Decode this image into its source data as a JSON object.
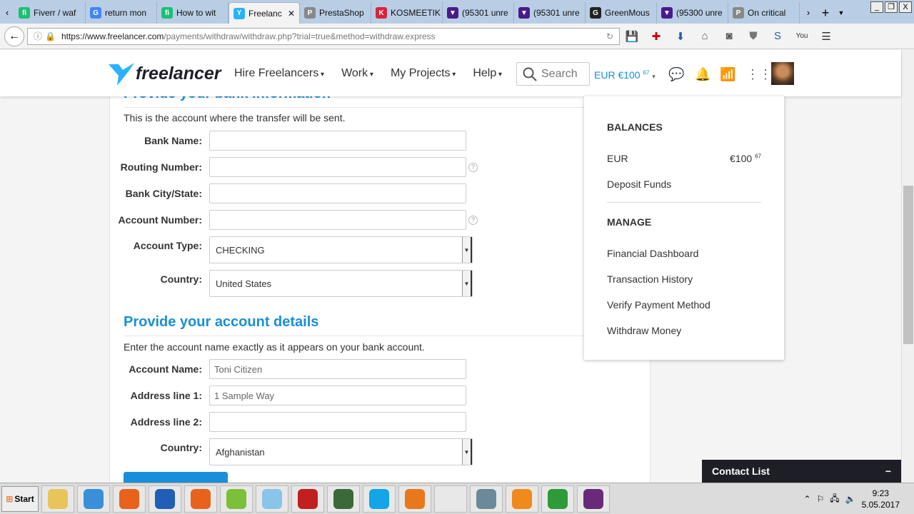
{
  "browser": {
    "tabs": [
      {
        "label": "Fiverr / waf",
        "color": "#1dbf73",
        "glyph": "fi"
      },
      {
        "label": "return mon",
        "color": "#4285f4",
        "glyph": "G"
      },
      {
        "label": "How to wit",
        "color": "#1dbf73",
        "glyph": "fi"
      },
      {
        "label": "Freelanc",
        "color": "#29b2fe",
        "glyph": "Y",
        "active": true
      },
      {
        "label": "PrestaShop",
        "color": "#888888",
        "glyph": "P"
      },
      {
        "label": "KOSMEETIK",
        "color": "#d9233d",
        "glyph": "K"
      },
      {
        "label": "(95301 unre",
        "color": "#4b1a8a",
        "glyph": "▼"
      },
      {
        "label": "(95301 unre",
        "color": "#4b1a8a",
        "glyph": "▼"
      },
      {
        "label": "GreenMous",
        "color": "#222222",
        "glyph": "G"
      },
      {
        "label": "(95300 unre",
        "color": "#4b1a8a",
        "glyph": "▼"
      },
      {
        "label": "On critical",
        "color": "#888888",
        "glyph": "P"
      }
    ],
    "url_domain": "https://www.freelancer.com",
    "url_path": "/payments/withdraw/withdraw.php?trial=true&method=withdraw.express"
  },
  "header": {
    "logo": "freelancer",
    "menu": [
      "Hire Freelancers",
      "Work",
      "My Projects",
      "Help"
    ],
    "search_placeholder": "Search",
    "balance": "EUR €100",
    "balance_cents": "67"
  },
  "bank": {
    "title": "Provide your bank information",
    "description": "This is the account where the transfer will be sent.",
    "fields": {
      "bank_name": {
        "label": "Bank Name:",
        "value": ""
      },
      "routing": {
        "label": "Routing Number:",
        "value": ""
      },
      "city": {
        "label": "Bank City/State:",
        "value": ""
      },
      "account_number": {
        "label": "Account Number:",
        "value": ""
      },
      "account_type": {
        "label": "Account Type:",
        "value": "CHECKING"
      },
      "country": {
        "label": "Country:",
        "value": "United States"
      }
    },
    "help": "?"
  },
  "account": {
    "title": "Provide your account details",
    "description": "Enter the account name exactly as it appears on your bank account.",
    "fields": {
      "name": {
        "label": "Account Name:",
        "placeholder": "Toni Citizen"
      },
      "addr1": {
        "label": "Address line 1:",
        "placeholder": "1 Sample Way"
      },
      "addr2": {
        "label": "Address line 2:",
        "placeholder": ""
      },
      "country": {
        "label": "Country:",
        "value": "Afghanistan"
      }
    }
  },
  "dropdown": {
    "balances_heading": "BALANCES",
    "currency": "EUR",
    "amount": "€100",
    "amount_cents": "67",
    "deposit": "Deposit Funds",
    "manage_heading": "MANAGE",
    "items": [
      "Financial Dashboard",
      "Transaction History",
      "Verify Payment Method",
      "Withdraw Money"
    ]
  },
  "contact_list": {
    "label": "Contact List",
    "toggle": "−"
  },
  "taskbar": {
    "start": "Start",
    "apps": [
      "#e8c55a",
      "#3a8fd8",
      "#e8621c",
      "#1f5fb5",
      "#e8621c",
      "#7bbf3a",
      "#8ac4e8",
      "#c21f1f",
      "#3a6a3a",
      "#12a5e8",
      "#e8781c",
      "#e8e8e8",
      "#6a8a9a",
      "#f08a1c",
      "#2f9a3a",
      "#6a2a7a"
    ],
    "time": "9:23",
    "date": "5.05.2017"
  }
}
